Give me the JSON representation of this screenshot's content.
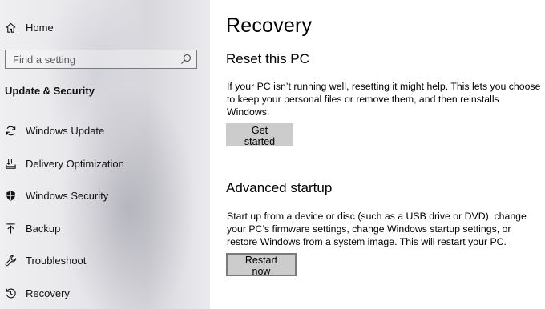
{
  "sidebar": {
    "home_label": "Home",
    "search": {
      "placeholder": "Find a setting"
    },
    "section_title": "Update & Security",
    "items": [
      {
        "label": "Windows Update"
      },
      {
        "label": "Delivery Optimization"
      },
      {
        "label": "Windows Security"
      },
      {
        "label": "Backup"
      },
      {
        "label": "Troubleshoot"
      },
      {
        "label": "Recovery"
      }
    ]
  },
  "main": {
    "title": "Recovery",
    "reset": {
      "heading": "Reset this PC",
      "description": "If your PC isn’t running well, resetting it might help. This lets you choose to keep your personal files or remove them, and then reinstalls Windows.",
      "button_label": "Get started"
    },
    "advanced": {
      "heading": "Advanced startup",
      "description": "Start up from a device or disc (such as a USB drive or DVD), change your PC’s firmware settings, change Windows startup settings, or restore Windows from a system image. This will restart your PC.",
      "button_label": "Restart now"
    }
  },
  "icons": {
    "home": "home-icon",
    "search": "search-icon",
    "windows_update": "sync-icon",
    "delivery_optimization": "delivery-icon",
    "windows_security": "shield-icon",
    "backup": "backup-icon",
    "troubleshoot": "wrench-icon",
    "recovery": "recovery-icon"
  }
}
